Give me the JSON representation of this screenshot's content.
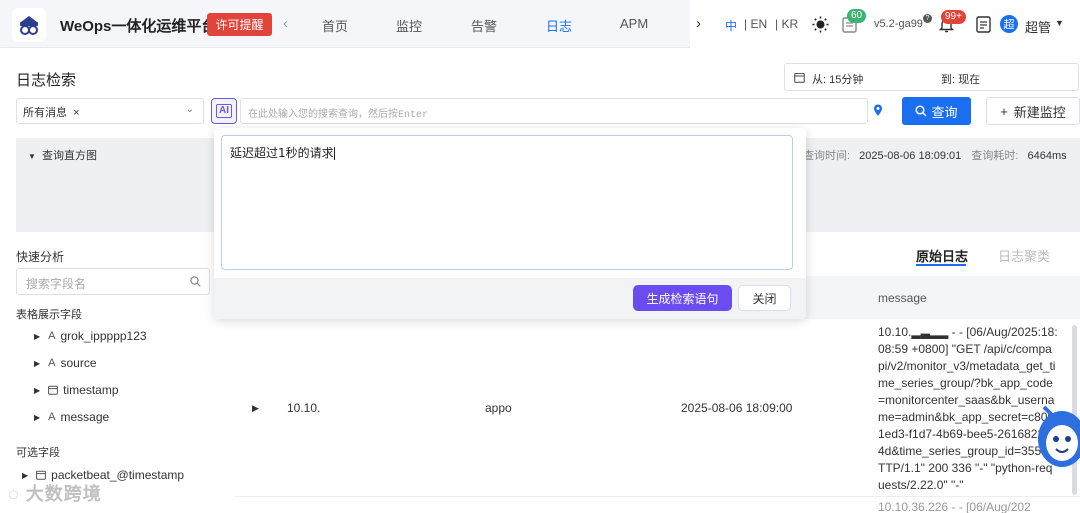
{
  "header": {
    "app_title": "WeOps一体化运维平台",
    "license_button": "许可提醒",
    "nav_tabs": [
      "首页",
      "监控",
      "告警",
      "日志",
      "APM"
    ],
    "active_tab": "日志",
    "languages": [
      "中",
      "| EN",
      "| KR"
    ],
    "notes_badge": "60",
    "version": "v5.2-ga99",
    "alerts_badge": "99+",
    "avatar_text": "超",
    "user_name": "超管"
  },
  "page": {
    "title": "日志检索",
    "time_from_label": "从: 15分钟",
    "time_to_label": "到: 现在"
  },
  "query": {
    "message_tag": "所有消息",
    "ai_label": "AI",
    "placeholder": "在此处输入您的搜索查询，然后按Enter",
    "search_button": "查询",
    "new_monitor_button": "新建监控"
  },
  "histogram": {
    "toggle_label": "查询直方图",
    "query_time_label": "查询时间:",
    "query_time_value": "2025-08-06 18:09:01",
    "query_duration_label": "查询耗时:",
    "query_duration_value": "6464ms"
  },
  "sidebar": {
    "quick_analysis": "快速分析",
    "field_search_placeholder": "搜索字段名",
    "table_fields_label": "表格展示字段",
    "table_fields": [
      {
        "type": "A",
        "name": "grok_ippppp123"
      },
      {
        "type": "A",
        "name": "source"
      },
      {
        "type": "cal",
        "name": "timestamp"
      },
      {
        "type": "A",
        "name": "message"
      }
    ],
    "optional_fields_label": "可选字段",
    "optional_fields": [
      {
        "type": "cal",
        "name": "packetbeat_@timestamp"
      }
    ]
  },
  "results": {
    "tab_raw": "原始日志",
    "tab_cluster": "日志聚类",
    "message_column": "message",
    "row": {
      "ip": "10.10.",
      "source": "appo",
      "timestamp": "2025-08-06 18:09:00",
      "message": "10.10.▂▃▂▂ - - [06/Aug/2025:18:08:59 +0800] \"GET /api/c/compapi/v2/monitor_v3/metadata_get_time_series_group/?bk_app_code=monitorcenter_saas&bk_username=admin&bk_app_secret=c8001ed3-f1d7-4b69-bee5-26168227f4d&time_series_group_id=355 HTTP/1.1\" 200 336 \"-\" \"python-requests/2.22.0\" \"-\""
    },
    "next_row_preview": "10.10.36.226 - - [06/Aug/202"
  },
  "ai_popup": {
    "input_text": "延迟超过1秒的请求",
    "generate_button": "生成检索语句",
    "close_button": "关闭"
  },
  "watermark": "大数跨境",
  "colors": {
    "primary": "#1a6ff0",
    "ai_purple": "#6a4cf0",
    "license_red": "#e0443a"
  }
}
